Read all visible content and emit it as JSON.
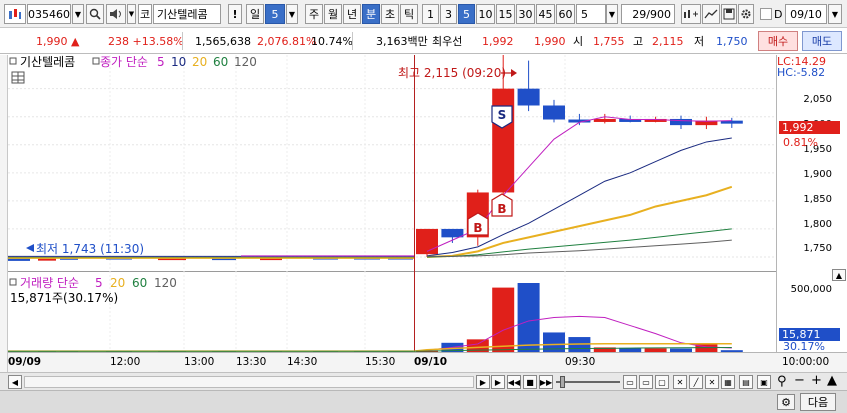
{
  "toolbar": {
    "code": "035460",
    "search_icon": "search-icon",
    "speaker_icon": "speaker-icon",
    "market": "코",
    "stock_name": "기산텔레콤",
    "alert": "!",
    "period_label": "일",
    "period_value": "5",
    "periods": [
      "주",
      "월",
      "년",
      "분",
      "초",
      "틱"
    ],
    "selected_period": "분",
    "minutes": [
      "1",
      "3",
      "5",
      "10",
      "15",
      "30",
      "45",
      "60"
    ],
    "selected_minute": "5",
    "count": "5",
    "page_info": "29/900",
    "date_checkbox_label": "D",
    "date": "09/10"
  },
  "quote": {
    "price": "1,990",
    "change_arrow": "▲",
    "change": "238",
    "change_pct": "+13.58%",
    "volume": "1,565,638",
    "volume_ratio": "2,076.81%",
    "turnover": "10.74%",
    "amount": "3,163백만",
    "ask_label": "최우선",
    "ask": "1,992",
    "bid": "1,990",
    "open_label": "시",
    "open": "1,755",
    "high_label": "고",
    "high": "2,115",
    "low_label": "저",
    "low": "1,750",
    "buy_button": "매수",
    "sell_button": "매도"
  },
  "price_panel": {
    "legend_name": "기산텔레콤",
    "ma_label": "종가 단순",
    "ma_periods": [
      "5",
      "10",
      "20",
      "60",
      "120"
    ],
    "ma_colors": [
      "#c020c0",
      "#1a2a80",
      "#e8b020",
      "#208040",
      "#606060"
    ],
    "high_annotation": "최고 2,115 (09:20)",
    "low_annotation": "최저 1,743 (11:30)",
    "lc_label": "LC:14.29",
    "hc_label": "HC:-5.82",
    "current_price": "1,992",
    "current_pct": "0.81%",
    "yticks": [
      "2,050",
      "2,000",
      "1,950",
      "1,900",
      "1,850",
      "1,800",
      "1,750"
    ],
    "signals": [
      "B",
      "B",
      "S"
    ]
  },
  "volume_panel": {
    "legend_name": "거래량 단순",
    "ma_periods": [
      "5",
      "20",
      "60",
      "120"
    ],
    "info": "15,871주(30.17%)",
    "ytick": "500,000",
    "current_volume": "15,871",
    "current_pct": "30.17%"
  },
  "xaxis": {
    "labels": [
      "09/09",
      "12:00",
      "13:00",
      "13:30",
      "14:30",
      "15:30",
      "09/10",
      "09:30",
      "10:00:00"
    ]
  },
  "bottom": {
    "next_button": "다음"
  },
  "chart_data": {
    "type": "candlestick",
    "title": "기산텔레콤",
    "ylim": [
      1725,
      2110
    ],
    "candles_day2": [
      {
        "o": 1755,
        "h": 1800,
        "l": 1750,
        "c": 1800
      },
      {
        "o": 1800,
        "h": 1790,
        "l": 1775,
        "c": 1785
      },
      {
        "o": 1785,
        "h": 1870,
        "l": 1770,
        "c": 1865
      },
      {
        "o": 1865,
        "h": 2115,
        "l": 1840,
        "c": 2050
      },
      {
        "o": 2050,
        "h": 2100,
        "l": 2010,
        "c": 2020
      },
      {
        "o": 2020,
        "h": 2030,
        "l": 1990,
        "c": 1995
      },
      {
        "o": 1995,
        "h": 2005,
        "l": 1985,
        "c": 1993
      },
      {
        "o": 1993,
        "h": 2005,
        "l": 1988,
        "c": 1996
      },
      {
        "o": 1996,
        "h": 2002,
        "l": 1990,
        "c": 1993
      },
      {
        "o": 1993,
        "h": 2000,
        "l": 1990,
        "c": 1996
      },
      {
        "o": 1996,
        "h": 2002,
        "l": 1978,
        "c": 1985
      },
      {
        "o": 1985,
        "h": 2000,
        "l": 1978,
        "c": 1993
      },
      {
        "o": 1993,
        "h": 1998,
        "l": 1980,
        "c": 1992
      }
    ],
    "ma": {
      "5": [
        1760,
        1780,
        1800,
        1860,
        1910,
        1960,
        1990,
        2000,
        1995,
        1995,
        1993,
        1992,
        1993
      ],
      "10": [
        1752,
        1758,
        1768,
        1790,
        1810,
        1835,
        1860,
        1885,
        1900,
        1920,
        1940,
        1955,
        1962
      ],
      "20": [
        1750,
        1752,
        1760,
        1775,
        1785,
        1795,
        1805,
        1815,
        1825,
        1840,
        1850,
        1860,
        1875
      ],
      "60": [
        1750,
        1751,
        1754,
        1759,
        1764,
        1768,
        1772,
        1776,
        1780,
        1785,
        1790,
        1795,
        1800
      ],
      "120": [
        1751,
        1751,
        1752,
        1754,
        1757,
        1759,
        1761,
        1764,
        1767,
        1770,
        1773,
        1776,
        1780
      ]
    },
    "volume_day2": [
      15000,
      80000,
      110000,
      560000,
      600000,
      170000,
      130000,
      40000,
      36000,
      32000,
      30000,
      65000,
      15871
    ],
    "volume_ylim": [
      0,
      600000
    ]
  }
}
